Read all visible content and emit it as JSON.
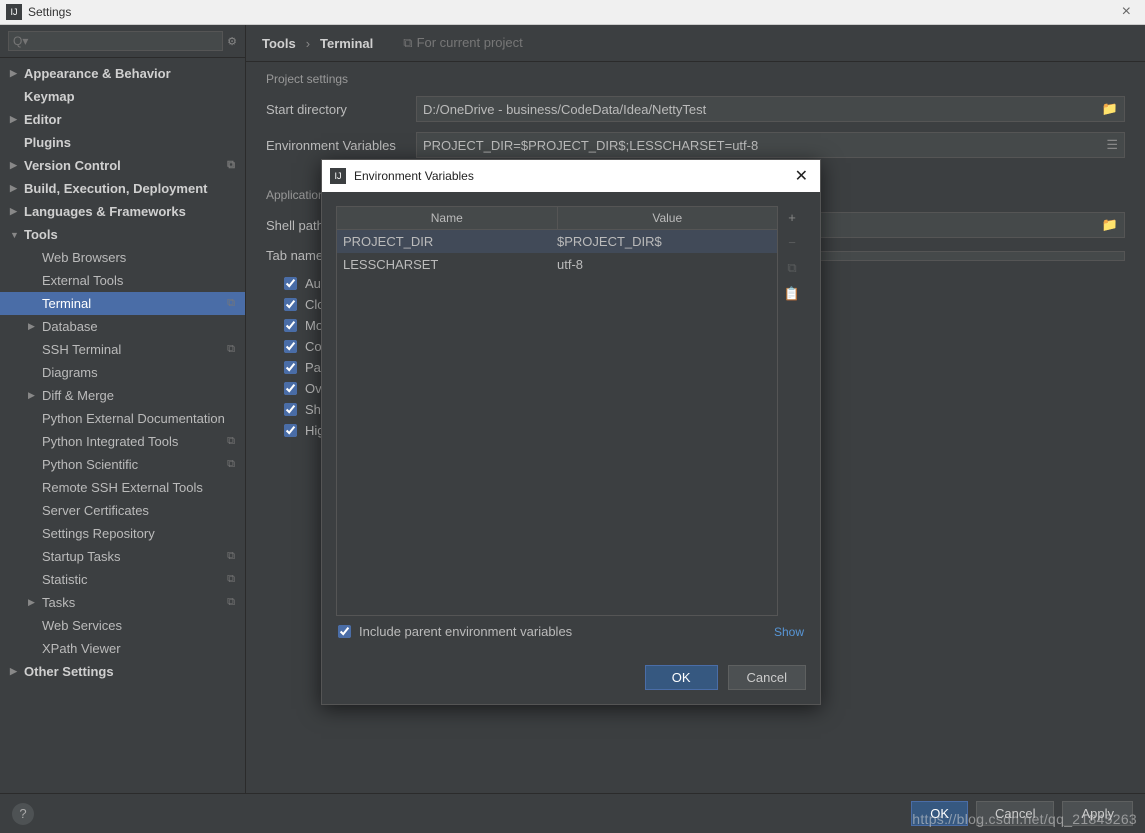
{
  "window": {
    "title": "Settings"
  },
  "sidebar": {
    "search_placeholder": "",
    "items": [
      {
        "label": "Appearance & Behavior",
        "arrow": "▶",
        "bold": true
      },
      {
        "label": "Keymap",
        "arrow": "",
        "bold": true
      },
      {
        "label": "Editor",
        "arrow": "▶",
        "bold": true
      },
      {
        "label": "Plugins",
        "arrow": "",
        "bold": true
      },
      {
        "label": "Version Control",
        "arrow": "▶",
        "bold": true,
        "badge": "⧉"
      },
      {
        "label": "Build, Execution, Deployment",
        "arrow": "▶",
        "bold": true
      },
      {
        "label": "Languages & Frameworks",
        "arrow": "▶",
        "bold": true
      },
      {
        "label": "Tools",
        "arrow": "▼",
        "bold": true
      }
    ],
    "tools_children": [
      {
        "label": "Web Browsers",
        "arrow": ""
      },
      {
        "label": "External Tools",
        "arrow": ""
      },
      {
        "label": "Terminal",
        "arrow": "",
        "selected": true,
        "badge": "⧉"
      },
      {
        "label": "Database",
        "arrow": "▶"
      },
      {
        "label": "SSH Terminal",
        "arrow": "",
        "badge": "⧉"
      },
      {
        "label": "Diagrams",
        "arrow": ""
      },
      {
        "label": "Diff & Merge",
        "arrow": "▶"
      },
      {
        "label": "Python External Documentation",
        "arrow": ""
      },
      {
        "label": "Python Integrated Tools",
        "arrow": "",
        "badge": "⧉"
      },
      {
        "label": "Python Scientific",
        "arrow": "",
        "badge": "⧉"
      },
      {
        "label": "Remote SSH External Tools",
        "arrow": ""
      },
      {
        "label": "Server Certificates",
        "arrow": ""
      },
      {
        "label": "Settings Repository",
        "arrow": ""
      },
      {
        "label": "Startup Tasks",
        "arrow": "",
        "badge": "⧉"
      },
      {
        "label": "Statistic",
        "arrow": "",
        "badge": "⧉"
      },
      {
        "label": "Tasks",
        "arrow": "▶",
        "badge": "⧉"
      },
      {
        "label": "Web Services",
        "arrow": ""
      },
      {
        "label": "XPath Viewer",
        "arrow": ""
      }
    ],
    "other_settings": {
      "label": "Other Settings",
      "arrow": "▶"
    }
  },
  "breadcrumb": {
    "a": "Tools",
    "b": "Terminal",
    "hint": "For current project"
  },
  "project_settings": {
    "title": "Project settings",
    "start_dir_label": "Start directory",
    "start_dir_value": "D:/OneDrive - business/CodeData/Idea/NettyTest",
    "env_label": "Environment Variables",
    "env_value": "PROJECT_DIR=$PROJECT_DIR$;LESSCHARSET=utf-8"
  },
  "app_settings": {
    "title": "Application settings",
    "shell_label": "Shell path",
    "tab_label": "Tab name",
    "checks": [
      "Audible bell",
      "Close session when it ends",
      "Mouse reporting",
      "Copy to clipboard on selection",
      "Paste on middle mouse button click",
      "Override IDE shortcuts",
      "Shell integration",
      "Highlight hyperlinks"
    ]
  },
  "dialog": {
    "title": "Environment Variables",
    "col_name": "Name",
    "col_value": "Value",
    "rows": [
      {
        "name": "PROJECT_DIR",
        "value": "$PROJECT_DIR$",
        "sel": true
      },
      {
        "name": "LESSCHARSET",
        "value": "utf-8"
      }
    ],
    "include_label": "Include parent environment variables",
    "show": "Show",
    "ok": "OK",
    "cancel": "Cancel"
  },
  "footer": {
    "ok": "OK",
    "cancel": "Cancel",
    "apply": "Apply"
  },
  "watermark": "https://blog.csdn.net/qq_21845263"
}
